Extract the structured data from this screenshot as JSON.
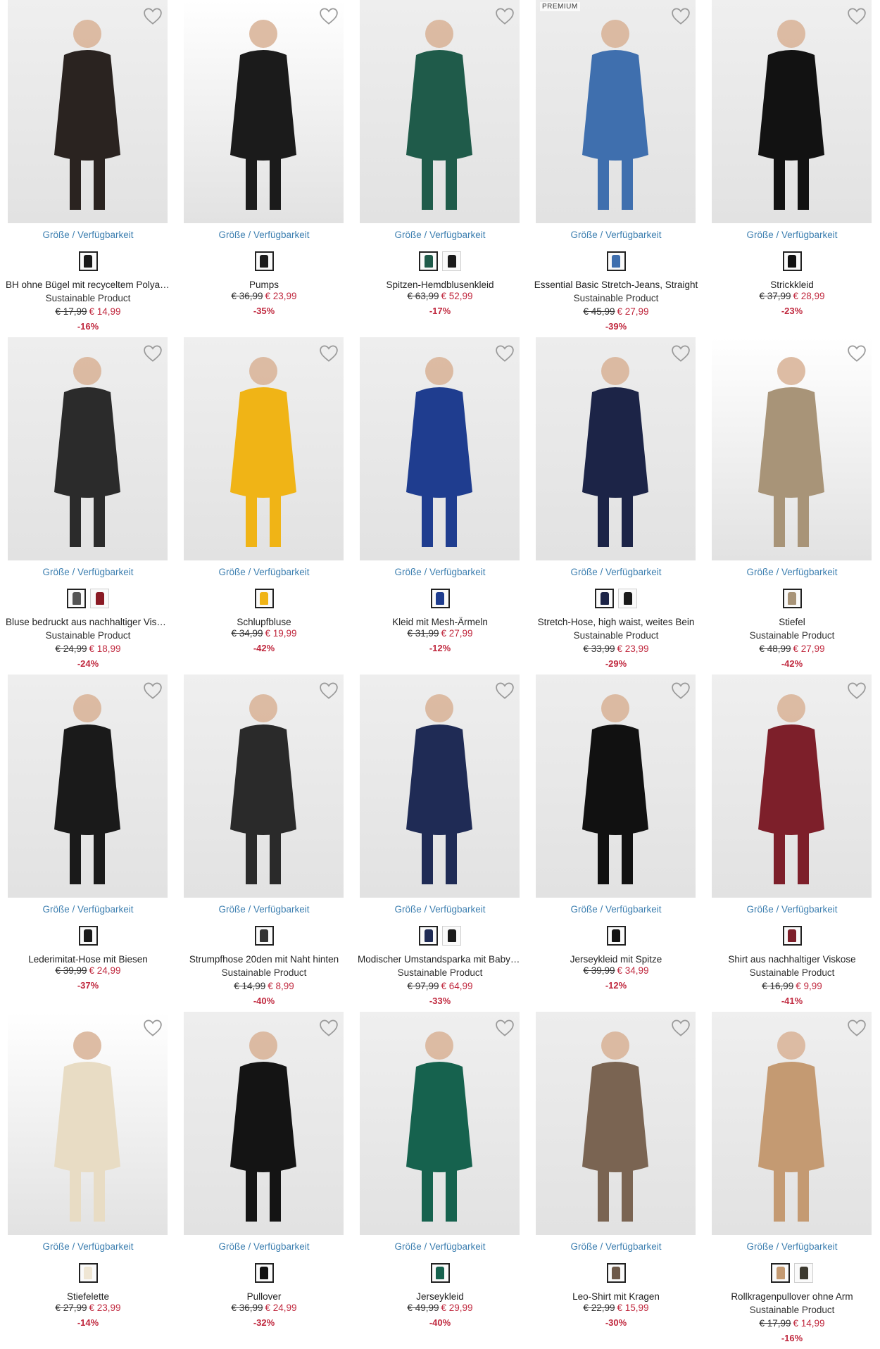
{
  "labels": {
    "availability": "Größe / Verfügbarkeit",
    "sustainable": "Sustainable Product",
    "premium": "PREMIUM"
  },
  "colors": {
    "link": "#3d7fb0",
    "sale": "#c0283e"
  },
  "products": [
    {
      "name": "BH ohne Bügel mit recyceltem Polyamid",
      "sustainable": true,
      "old_price": "€ 17,99",
      "new_price": "€ 14,99",
      "discount": "-16%",
      "swatches": [
        "#1a1a1a"
      ],
      "image_bg": "#efefef",
      "figure": "#2a2320",
      "premium": false
    },
    {
      "name": "Pumps",
      "sustainable": false,
      "old_price": "€ 36,99",
      "new_price": "€ 23,99",
      "discount": "-35%",
      "swatches": [
        "#1c1c1c"
      ],
      "image_bg": "#ffffff",
      "figure": "#1b1b1b",
      "premium": false
    },
    {
      "name": "Spitzen-Hemdblusenkleid",
      "sustainable": false,
      "old_price": "€ 63,99",
      "new_price": "€ 52,99",
      "discount": "-17%",
      "swatches": [
        "#1f5b4a",
        "#1a1a1a"
      ],
      "image_bg": "#eeeeee",
      "figure": "#1f5b4a",
      "premium": false
    },
    {
      "name": "Essential Basic Stretch-Jeans, Straight",
      "sustainable": true,
      "old_price": "€ 45,99",
      "new_price": "€ 27,99",
      "discount": "-39%",
      "swatches": [
        "#3f6fae"
      ],
      "image_bg": "#ededed",
      "figure": "#3f6fae",
      "premium": true
    },
    {
      "name": "Strickkleid",
      "sustainable": false,
      "old_price": "€ 37,99",
      "new_price": "€ 28,99",
      "discount": "-23%",
      "swatches": [
        "#111111"
      ],
      "image_bg": "#efefef",
      "figure": "#121212",
      "premium": false
    },
    {
      "name": "Bluse bedruckt aus nachhaltiger Viskose",
      "sustainable": true,
      "old_price": "€ 24,99",
      "new_price": "€ 18,99",
      "discount": "-24%",
      "swatches": [
        "#555555",
        "#8a1a24"
      ],
      "image_bg": "#eeeeee",
      "figure": "#2b2b2b",
      "premium": false
    },
    {
      "name": "Schlupfbluse",
      "sustainable": false,
      "old_price": "€ 34,99",
      "new_price": "€ 19,99",
      "discount": "-42%",
      "swatches": [
        "#f0b416"
      ],
      "image_bg": "#efefef",
      "figure": "#f0b416",
      "premium": false
    },
    {
      "name": "Kleid mit Mesh-Ärmeln",
      "sustainable": false,
      "old_price": "€ 31,99",
      "new_price": "€ 27,99",
      "discount": "-12%",
      "swatches": [
        "#1f3d8f"
      ],
      "image_bg": "#eeeeee",
      "figure": "#1f3d8f",
      "premium": false
    },
    {
      "name": "Stretch-Hose, high waist, weites Bein",
      "sustainable": true,
      "old_price": "€ 33,99",
      "new_price": "€ 23,99",
      "discount": "-29%",
      "swatches": [
        "#1c2447",
        "#1a1a1a"
      ],
      "image_bg": "#ededed",
      "figure": "#1c2447",
      "premium": false
    },
    {
      "name": "Stiefel",
      "sustainable": true,
      "old_price": "€ 48,99",
      "new_price": "€ 27,99",
      "discount": "-42%",
      "swatches": [
        "#a89478"
      ],
      "image_bg": "#ffffff",
      "figure": "#a89478",
      "premium": false
    },
    {
      "name": "Lederimitat-Hose mit Biesen",
      "sustainable": false,
      "old_price": "€ 39,99",
      "new_price": "€ 24,99",
      "discount": "-37%",
      "swatches": [
        "#1a1a1a"
      ],
      "image_bg": "#eeeeee",
      "figure": "#1a1a1a",
      "premium": false
    },
    {
      "name": "Strumpfhose 20den mit Naht hinten",
      "sustainable": true,
      "old_price": "€ 14,99",
      "new_price": "€ 8,99",
      "discount": "-40%",
      "swatches": [
        "#333333"
      ],
      "image_bg": "#efefef",
      "figure": "#2a2a2a",
      "premium": false
    },
    {
      "name": "Modischer Umstandsparka mit Babyeinsatz",
      "sustainable": true,
      "old_price": "€ 97,99",
      "new_price": "€ 64,99",
      "discount": "-33%",
      "swatches": [
        "#1f2b55",
        "#1a1a1a"
      ],
      "image_bg": "#eeeeee",
      "figure": "#1f2b55",
      "premium": false
    },
    {
      "name": "Jerseykleid mit Spitze",
      "sustainable": false,
      "old_price": "€ 39,99",
      "new_price": "€ 34,99",
      "discount": "-12%",
      "swatches": [
        "#111111"
      ],
      "image_bg": "#ededed",
      "figure": "#111111",
      "premium": false
    },
    {
      "name": "Shirt aus nachhaltiger Viskose",
      "sustainable": true,
      "old_price": "€ 16,99",
      "new_price": "€ 9,99",
      "discount": "-41%",
      "swatches": [
        "#7d1f2a"
      ],
      "image_bg": "#efefef",
      "figure": "#7d1f2a",
      "premium": false
    },
    {
      "name": "Stiefelette",
      "sustainable": false,
      "old_price": "€ 27,99",
      "new_price": "€ 23,99",
      "discount": "-14%",
      "swatches": [
        "#efe6d4"
      ],
      "image_bg": "#ffffff",
      "figure": "#e8dcc4",
      "premium": false
    },
    {
      "name": "Pullover",
      "sustainable": false,
      "old_price": "€ 36,99",
      "new_price": "€ 24,99",
      "discount": "-32%",
      "swatches": [
        "#111111"
      ],
      "image_bg": "#eeeeee",
      "figure": "#141414",
      "premium": false
    },
    {
      "name": "Jerseykleid",
      "sustainable": false,
      "old_price": "€ 49,99",
      "new_price": "€ 29,99",
      "discount": "-40%",
      "swatches": [
        "#16624e"
      ],
      "image_bg": "#efefef",
      "figure": "#16624e",
      "premium": false
    },
    {
      "name": "Leo-Shirt mit Kragen",
      "sustainable": false,
      "old_price": "€ 22,99",
      "new_price": "€ 15,99",
      "discount": "-30%",
      "swatches": [
        "#6e5a4a"
      ],
      "image_bg": "#ededed",
      "figure": "#7a6452",
      "premium": false
    },
    {
      "name": "Rollkragenpullover ohne Arm",
      "sustainable": true,
      "old_price": "€ 17,99",
      "new_price": "€ 14,99",
      "discount": "-16%",
      "swatches": [
        "#c49a72",
        "#3d3a30"
      ],
      "image_bg": "#efefef",
      "figure": "#c49a72",
      "premium": false
    }
  ]
}
